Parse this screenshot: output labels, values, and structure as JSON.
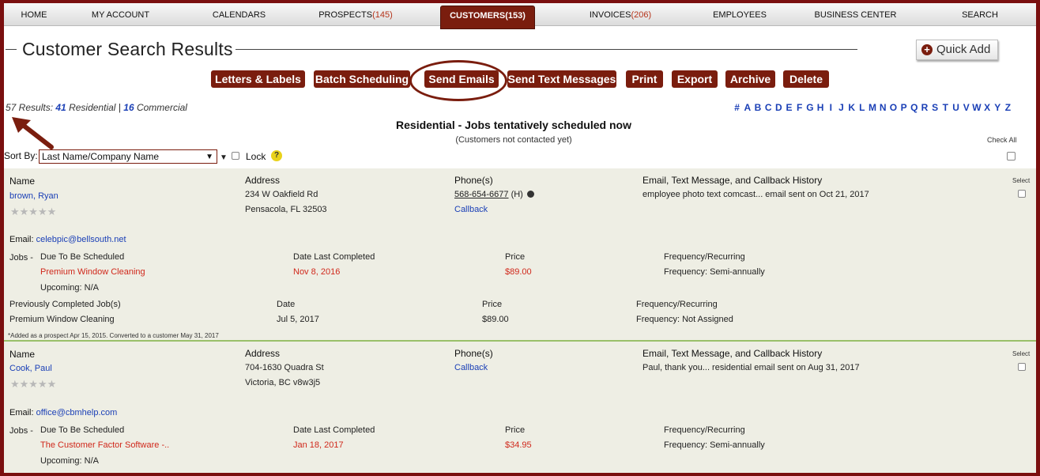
{
  "nav": {
    "home": "HOME",
    "account": "MY ACCOUNT",
    "calendars": "CALENDARS",
    "prospects": "PROSPECTS",
    "prospects_count": "(145)",
    "customers": "CUSTOMERS",
    "customers_count": "(153)",
    "invoices": "INVOICES",
    "invoices_count": "(206)",
    "employees": "EMPLOYEES",
    "business_center": "BUSINESS CENTER",
    "search": "SEARCH"
  },
  "page": {
    "title": "Customer Search Results",
    "quick_add": "Quick Add"
  },
  "actions": {
    "letters": "Letters & Labels",
    "batch": "Batch Scheduling",
    "send_emails": "Send Emails",
    "send_texts": "Send Text Messages",
    "print": "Print",
    "export": "Export",
    "archive": "Archive",
    "delete": "Delete"
  },
  "results": {
    "total": "57 Results:",
    "residential_count": "41",
    "residential_label": "Residential",
    "sep": "|",
    "commercial_count": "16",
    "commercial_label": "Commercial"
  },
  "alphabet": [
    "#",
    "A",
    "B",
    "C",
    "D",
    "E",
    "F",
    "G",
    "H",
    "I",
    "J",
    "K",
    "L",
    "M",
    "N",
    "O",
    "P",
    "Q",
    "R",
    "S",
    "T",
    "U",
    "V",
    "W",
    "X",
    "Y",
    "Z"
  ],
  "section": {
    "title": "Residential - Jobs tentatively scheduled now",
    "subtitle": "(Customers not contacted yet)",
    "check_all": "Check All"
  },
  "sort": {
    "label": "Sort By:",
    "value": "Last Name/Company Name",
    "lock": "Lock",
    "help": "?"
  },
  "labels": {
    "name": "Name",
    "address": "Address",
    "phones": "Phone(s)",
    "history": "Email, Text Message, and Callback History",
    "select": "Select",
    "email": "Email:",
    "jobs": "Jobs -",
    "due": "Due To Be Scheduled",
    "date_last": "Date Last Completed",
    "price": "Price",
    "freq": "Frequency/Recurring",
    "upcoming": "Upcoming:",
    "prev_jobs": "Previously Completed Job(s)",
    "date": "Date",
    "callback": "Callback"
  },
  "customers": [
    {
      "name": "brown, Ryan",
      "address1": "234 W Oakfield Rd",
      "address2": "Pensacola, FL 32503",
      "phone": "568-654-6677",
      "phone_type": "(H)",
      "history": "employee photo text comcast... email sent on Oct 21, 2017",
      "email": "celebpic@bellsouth.net",
      "job": "Premium Window Cleaning",
      "date_last": "Nov 8, 2016",
      "price": "$89.00",
      "frequency": "Frequency: Semi-annually",
      "upcoming": "N/A",
      "prev_job": "Premium Window Cleaning",
      "prev_date": "Jul 5, 2017",
      "prev_price": "$89.00",
      "prev_freq": "Frequency: Not Assigned",
      "note": "*Added as a prospect Apr 15, 2015. Converted to a customer May 31, 2017"
    },
    {
      "name": "Cook, Paul",
      "address1": "704-1630 Quadra St",
      "address2": "Victoria, BC v8w3j5",
      "history": "Paul, thank you... residential email sent on Aug 31, 2017",
      "email": "office@cbmhelp.com",
      "job": "The Customer Factor Software -..",
      "date_last": "Jan 18, 2017",
      "price": "$34.95",
      "frequency": "Frequency: Semi-annually",
      "upcoming": "N/A"
    }
  ],
  "colors": {
    "brand": "#7a1d0e",
    "link": "#1a3fb6",
    "alert": "#d0281b",
    "row_bg": "#eeeee4"
  }
}
